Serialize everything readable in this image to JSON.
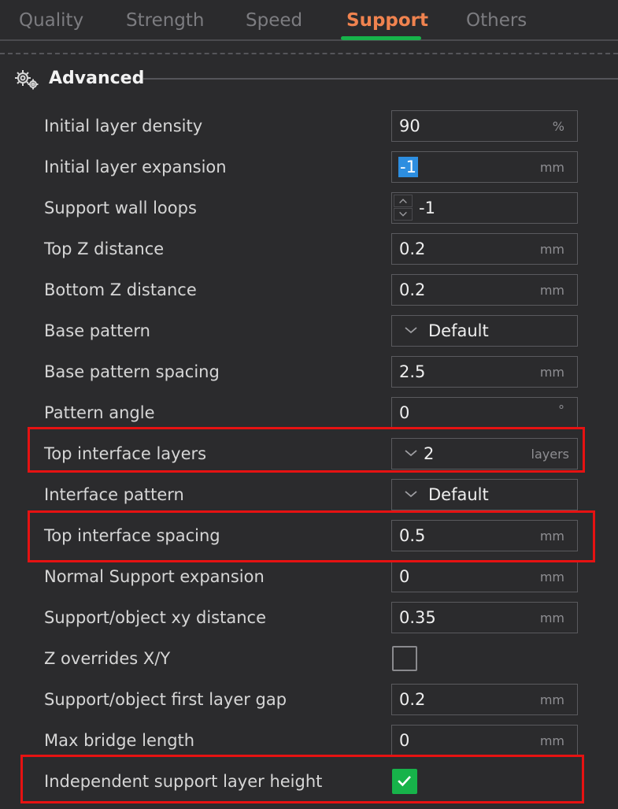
{
  "tabs": [
    {
      "label": "Quality",
      "active": false
    },
    {
      "label": "Strength",
      "active": false
    },
    {
      "label": "Speed",
      "active": false
    },
    {
      "label": "Support",
      "active": true
    },
    {
      "label": "Others",
      "active": false
    }
  ],
  "section": {
    "title": "Advanced",
    "icon": "gears-icon"
  },
  "settings": [
    {
      "label": "Initial layer density",
      "value": "90",
      "unit": "%",
      "kind": "text"
    },
    {
      "label": "Initial layer expansion",
      "value": "-1",
      "unit": "mm",
      "kind": "text-selected"
    },
    {
      "label": "Support wall loops",
      "value": "-1",
      "unit": "",
      "kind": "spin"
    },
    {
      "label": "Top Z distance",
      "value": "0.2",
      "unit": "mm",
      "kind": "text"
    },
    {
      "label": "Bottom Z distance",
      "value": "0.2",
      "unit": "mm",
      "kind": "text"
    },
    {
      "label": "Base pattern",
      "value": "Default",
      "unit": "",
      "kind": "combo"
    },
    {
      "label": "Base pattern spacing",
      "value": "2.5",
      "unit": "mm",
      "kind": "text"
    },
    {
      "label": "Pattern angle",
      "value": "0",
      "unit": "°",
      "kind": "text"
    },
    {
      "label": "Top interface layers",
      "value": "2",
      "unit": "layers",
      "kind": "combo"
    },
    {
      "label": "Interface pattern",
      "value": "Default",
      "unit": "",
      "kind": "combo"
    },
    {
      "label": "Top interface spacing",
      "value": "0.5",
      "unit": "mm",
      "kind": "text"
    },
    {
      "label": "Normal Support expansion",
      "value": "0",
      "unit": "mm",
      "kind": "text"
    },
    {
      "label": "Support/object xy distance",
      "value": "0.35",
      "unit": "mm",
      "kind": "text"
    },
    {
      "label": "Z overrides X/Y",
      "checked": false,
      "kind": "checkbox"
    },
    {
      "label": "Support/object first layer gap",
      "value": "0.2",
      "unit": "mm",
      "kind": "text"
    },
    {
      "label": "Max bridge length",
      "value": "0",
      "unit": "mm",
      "kind": "text"
    },
    {
      "label": "Independent support layer height",
      "checked": true,
      "kind": "checkbox"
    }
  ],
  "colors": {
    "background": "#2b2b2d",
    "accent_tab": "#f0834f",
    "accent_green": "#17b34a",
    "highlight": "#e61212",
    "selection": "#2d8ee0"
  }
}
